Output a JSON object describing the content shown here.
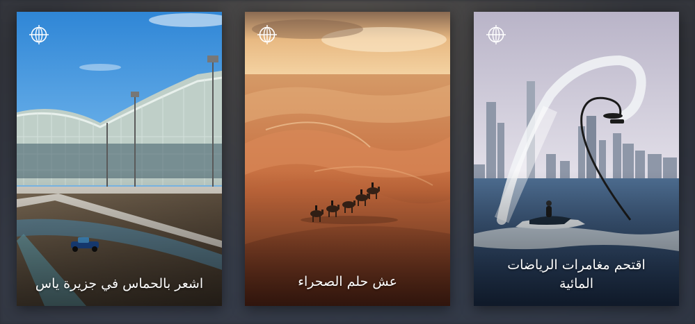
{
  "cards": [
    {
      "title": "اشعر بالحماس في جزيرة ياس",
      "icon": "globe-logo-icon",
      "scene": "yas-circuit-photo"
    },
    {
      "title": "عش حلم الصحراء",
      "icon": "globe-logo-icon",
      "scene": "desert-camels-photo"
    },
    {
      "title": "اقتحم مغامرات الرياضات المائية",
      "icon": "globe-logo-icon",
      "scene": "flyboard-skyline-photo"
    }
  ]
}
